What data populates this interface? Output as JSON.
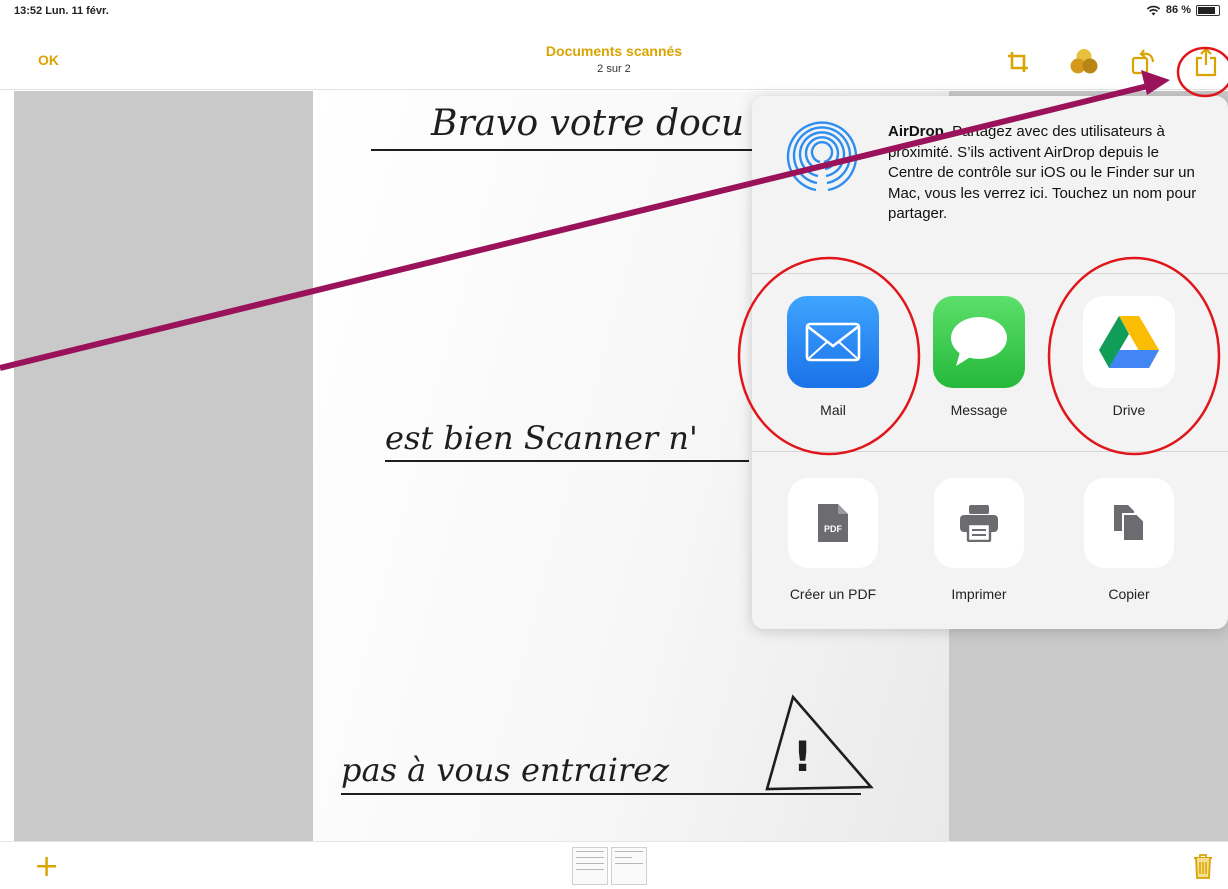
{
  "status_bar": {
    "time_date": "13:52  Lun. 11 févr.",
    "battery": "86 %",
    "battery_level": 0.86,
    "icons": [
      "wifi-icon",
      "battery-icon"
    ]
  },
  "nav": {
    "ok": "OK",
    "title": "Documents scannés",
    "subtitle": "2 sur 2",
    "icons": [
      "crop-icon",
      "filters-icon",
      "rotate-icon",
      "share-icon"
    ]
  },
  "document": {
    "lines": [
      "Bravo votre docu",
      "est bien Scanner n'",
      "pas à vous entrairez"
    ],
    "warning_glyph": "!"
  },
  "share_sheet": {
    "airdrop_title": "AirDrop",
    "airdrop_text": ". Partagez avec des utilisateurs à proximité. S’ils activent AirDrop depuis le Centre de contrôle sur iOS ou le Finder sur un Mac, vous les verrez ici. Touchez un nom pour partager.",
    "apps": [
      {
        "label": "Mail",
        "icon": "mail-icon"
      },
      {
        "label": "Message",
        "icon": "message-icon"
      },
      {
        "label": "Drive",
        "icon": "drive-icon"
      }
    ],
    "actions": [
      {
        "label": "Créer un PDF",
        "icon": "pdf-icon",
        "glyph": "PDF"
      },
      {
        "label": "Imprimer",
        "icon": "printer-icon"
      },
      {
        "label": "Copier",
        "icon": "copy-icon"
      }
    ]
  },
  "bottom_bar": {
    "add": "+",
    "icons": [
      "add-icon",
      "trash-icon"
    ]
  },
  "colors": {
    "accent": "#d9a400",
    "annotation_arrow": "#9a1259",
    "annotation_circle": "#e0161b",
    "mail_blue": "#1e86f4",
    "message_green": "#2fc443"
  }
}
